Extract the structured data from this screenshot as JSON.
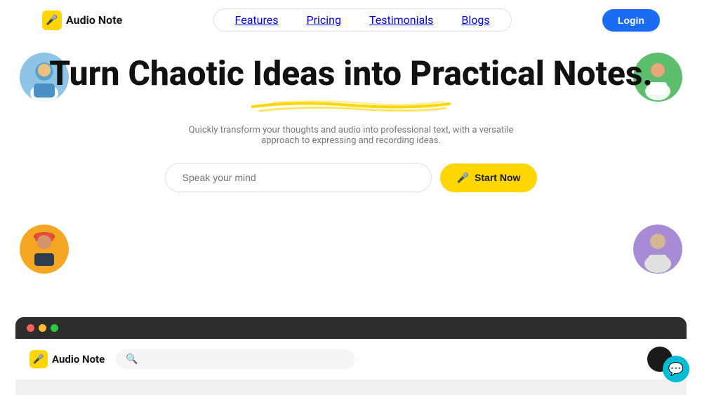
{
  "nav": {
    "logo_icon": "🎤",
    "logo_text": "Audio Note",
    "links": [
      {
        "label": "Features",
        "id": "features"
      },
      {
        "label": "Pricing",
        "id": "pricing"
      },
      {
        "label": "Testimonials",
        "id": "testimonials"
      },
      {
        "label": "Blogs",
        "id": "blogs"
      }
    ],
    "login_label": "Login"
  },
  "hero": {
    "title": "Turn Chaotic Ideas into Practical Notes.",
    "subtitle": "Quickly transform your thoughts and audio into professional text, with a versatile approach to expressing and recording ideas.",
    "input_placeholder": "Speak your mind",
    "start_button_label": "Start Now",
    "mic_icon": "🎤"
  },
  "avatars": {
    "top_left_emoji": "👤",
    "top_right_emoji": "👤",
    "mid_left_emoji": "👤",
    "mid_right_emoji": "👤"
  },
  "app_window": {
    "logo_icon": "🎤",
    "logo_text": "Audio Note",
    "search_placeholder": ""
  },
  "chat": {
    "icon": "💬"
  }
}
